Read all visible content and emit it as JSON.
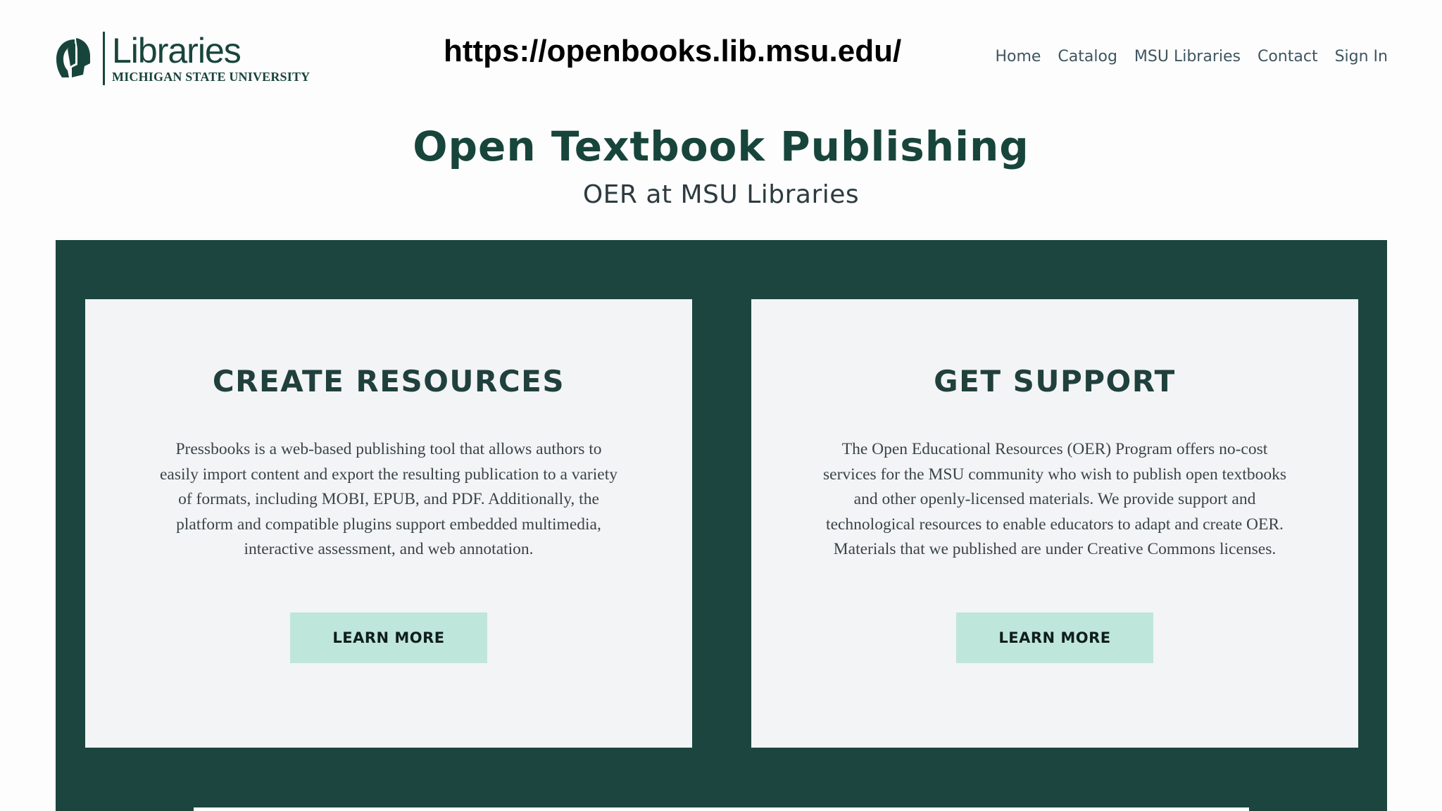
{
  "header": {
    "logo": {
      "libraries_text": "Libraries",
      "university_text": "MICHIGAN STATE UNIVERSITY"
    },
    "url": "https://openbooks.lib.msu.edu/",
    "nav": [
      "Home",
      "Catalog",
      "MSU Libraries",
      "Contact",
      "Sign In"
    ]
  },
  "hero": {
    "title": "Open Textbook Publishing",
    "subtitle": "OER at MSU Libraries"
  },
  "cards": [
    {
      "heading": "CREATE RESOURCES",
      "body": "Pressbooks is a web-based publishing tool that allows authors to easily import content and export the resulting publication to a variety of formats, including MOBI, EPUB, and PDF. Additionally, the platform and compatible plugins support embedded multimedia, interactive assessment, and web annotation.",
      "button": "LEARN MORE"
    },
    {
      "heading": "GET SUPPORT",
      "body": "The Open Educational Resources (OER) Program offers no-cost services for the MSU community who wish to publish open textbooks and other openly-licensed materials. We provide support and technological resources to enable educators to adapt and create OER. Materials that we published are under Creative Commons licenses.",
      "button": "LEARN MORE"
    }
  ],
  "colors": {
    "brand_green": "#18453b",
    "band_green": "#1c4540",
    "button_mint": "#bfe6db"
  },
  "icons": {
    "logo": "spartan-helmet-icon"
  }
}
